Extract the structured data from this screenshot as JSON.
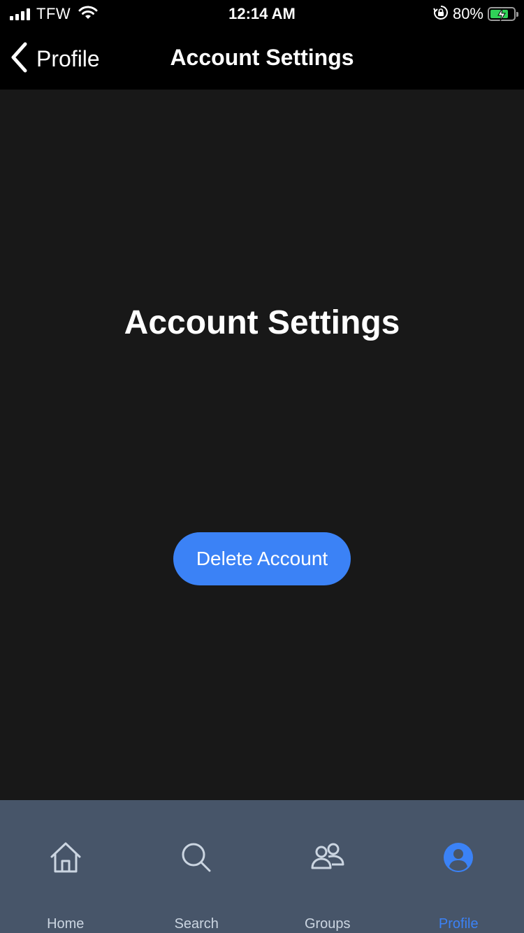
{
  "status_bar": {
    "carrier": "TFW",
    "time": "12:14 AM",
    "battery_percent": "80%",
    "battery_level": 0.8,
    "charging": true
  },
  "nav": {
    "back_label": "Profile",
    "title": "Account Settings"
  },
  "main": {
    "heading": "Account Settings",
    "delete_button_label": "Delete Account"
  },
  "tab_bar": {
    "tabs": [
      {
        "label": "Home",
        "icon": "home-icon"
      },
      {
        "label": "Search",
        "icon": "search-icon"
      },
      {
        "label": "Groups",
        "icon": "groups-icon"
      },
      {
        "label": "Profile",
        "icon": "profile-icon",
        "active": true
      }
    ]
  },
  "colors": {
    "accent": "#3b82f6",
    "content_bg": "#181818",
    "tab_bar_bg": "#475569",
    "tab_inactive": "#cbd5e1",
    "battery_fill": "#30d158"
  }
}
